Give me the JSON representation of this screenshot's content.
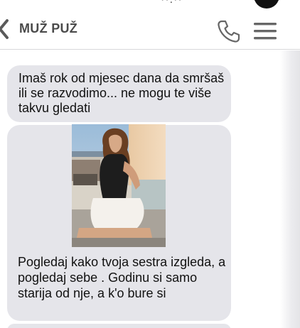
{
  "status_bar": {
    "time": "··:··",
    "icon": "camera-notch-icon"
  },
  "header": {
    "contact_name": "MUŽ PUŽ",
    "back_icon": "chevron-left-icon",
    "call_icon": "phone-icon",
    "menu_icon": "hamburger-menu-icon"
  },
  "messages": [
    {
      "direction": "incoming",
      "text": "Imaš rok od mjesec dana da smršaš ili se razvodimo... ne mogu te više takvu gledati"
    },
    {
      "direction": "incoming",
      "image": "photo-woman-sitting-on-terrace",
      "text": "Pogledaj kako tvoja sestra izgleda, a pogledaj sebe . Godinu si samo starija od nje, a k'o bure si"
    },
    {
      "direction": "incoming",
      "text": ""
    }
  ],
  "colors": {
    "bubble_incoming": "#e5e5ea",
    "header_text": "#4b4b4b",
    "message_text": "#111111",
    "divider": "#d8d8da"
  }
}
